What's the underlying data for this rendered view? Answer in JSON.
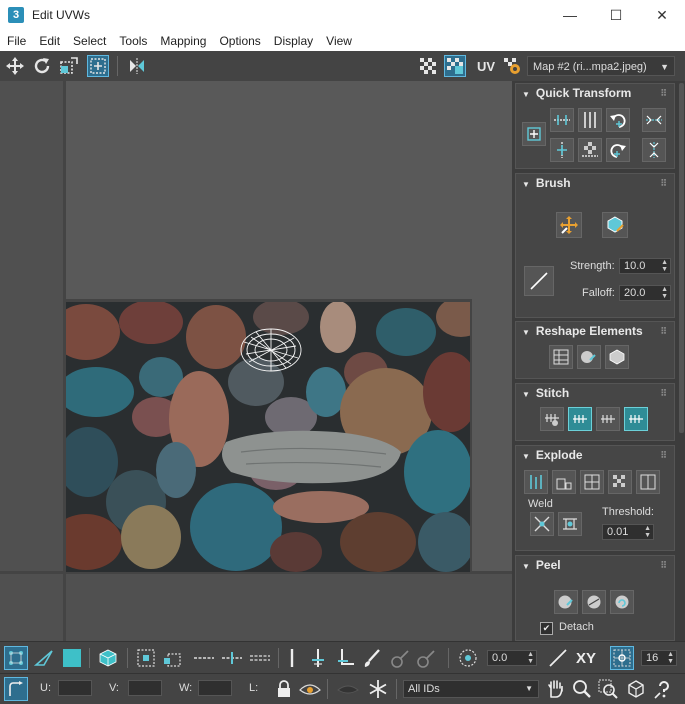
{
  "window": {
    "title": "Edit UVWs",
    "app_icon_letter": "3",
    "minimize": "—",
    "maximize": "☐",
    "close": "✕"
  },
  "menu": [
    "File",
    "Edit",
    "Select",
    "Tools",
    "Mapping",
    "Options",
    "Display",
    "View"
  ],
  "toolbar": {
    "uv_label": "UV",
    "map_select": "Map #2 (ri...mpa2.jpeg)"
  },
  "panel": {
    "quick_transform": {
      "title": "Quick Transform"
    },
    "brush": {
      "title": "Brush",
      "strength_label": "Strength:",
      "strength_value": "10.0",
      "falloff_label": "Falloff:",
      "falloff_value": "20.0"
    },
    "reshape": {
      "title": "Reshape Elements"
    },
    "stitch": {
      "title": "Stitch"
    },
    "explode": {
      "title": "Explode",
      "weld_label": "Weld",
      "threshold_label": "Threshold:",
      "threshold_value": "0.01"
    },
    "peel": {
      "title": "Peel",
      "detach_label": "Detach"
    }
  },
  "bottom": {
    "rotation_value": "0.0",
    "xy_label": "XY",
    "grid_value": "16",
    "u_label": "U:",
    "v_label": "V:",
    "w_label": "W:",
    "l_label": "L:",
    "ids_select": "All IDs"
  },
  "colors": {
    "accent": "#2f8c96",
    "active": "#2e6e8e",
    "ui_bg": "#444444",
    "viewport_bg": "#595959"
  }
}
